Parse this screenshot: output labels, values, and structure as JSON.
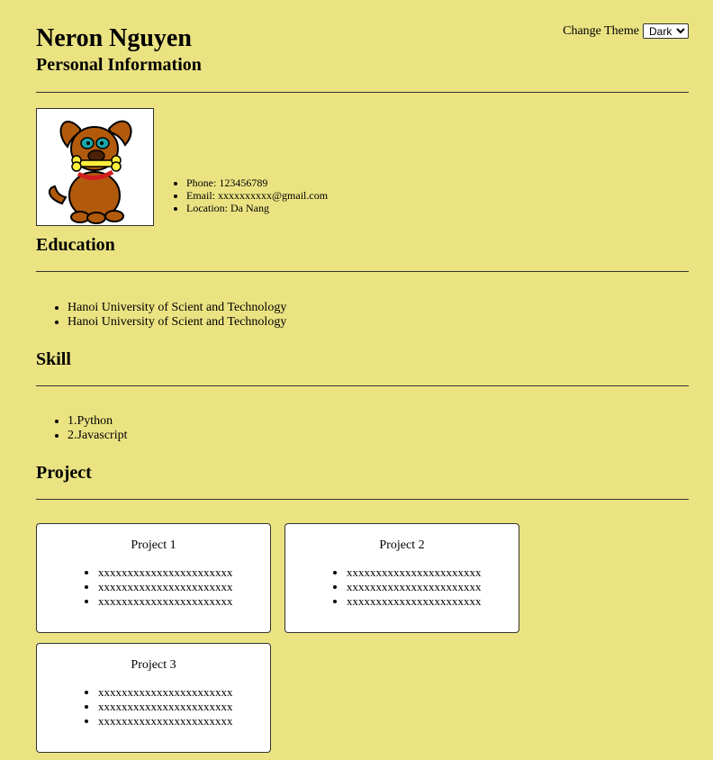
{
  "header": {
    "name": "Neron Nguyen",
    "subtitle": "Personal Information"
  },
  "theme": {
    "label": "Change Theme",
    "selected": "Dark",
    "options": [
      "Dark"
    ]
  },
  "avatar": {
    "icon": "dog-cartoon"
  },
  "contact": [
    "Phone: 123456789",
    "Email: xxxxxxxxxx@gmail.com",
    "Location: Da Nang"
  ],
  "education": {
    "title": "Education",
    "items": [
      "Hanoi University of Scient and Technology",
      "Hanoi University of Scient and Technology"
    ]
  },
  "skill": {
    "title": "Skill",
    "items": [
      "1.Python",
      "2.Javascript"
    ]
  },
  "project": {
    "title": "Project",
    "cards": [
      {
        "title": "Project 1",
        "items": [
          "xxxxxxxxxxxxxxxxxxxxxxx",
          "xxxxxxxxxxxxxxxxxxxxxxx",
          "xxxxxxxxxxxxxxxxxxxxxxx"
        ]
      },
      {
        "title": "Project 2",
        "items": [
          "xxxxxxxxxxxxxxxxxxxxxxx",
          "xxxxxxxxxxxxxxxxxxxxxxx",
          "xxxxxxxxxxxxxxxxxxxxxxx"
        ]
      },
      {
        "title": "Project 3",
        "items": [
          "xxxxxxxxxxxxxxxxxxxxxxx",
          "xxxxxxxxxxxxxxxxxxxxxxx",
          "xxxxxxxxxxxxxxxxxxxxxxx"
        ]
      }
    ]
  },
  "colors": {
    "background": "#ebe382",
    "card": "#ffffff",
    "rule": "#333333"
  }
}
